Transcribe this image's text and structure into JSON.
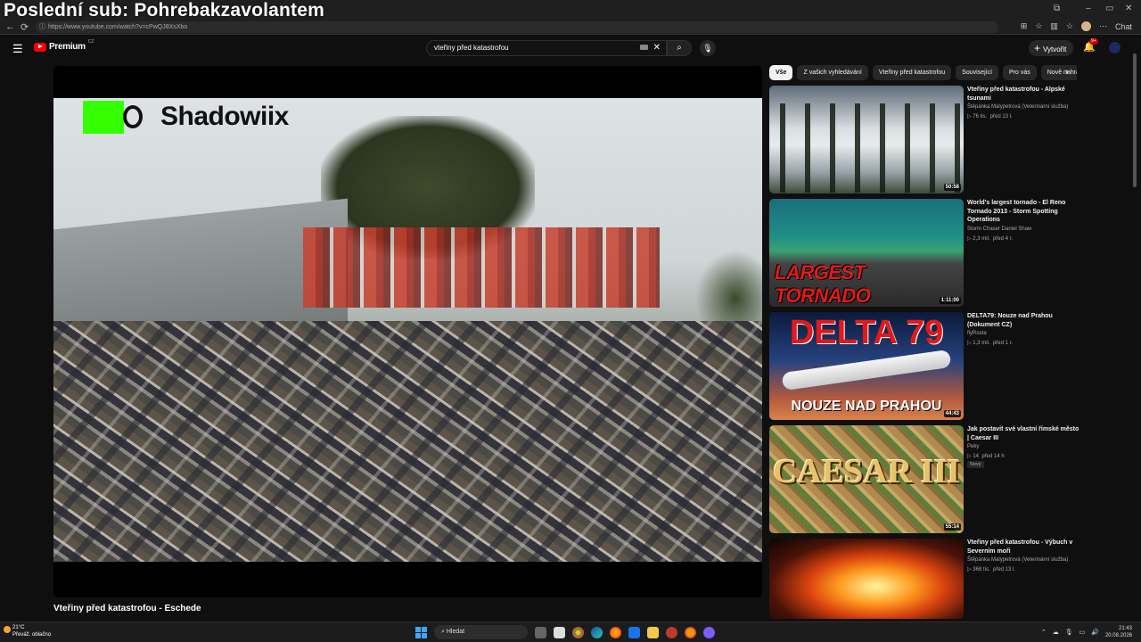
{
  "overlay": {
    "title": "Poslední sub: Pohrebakzavolantem"
  },
  "window": {
    "minimize": "–",
    "maximize": "▭",
    "close": "✕",
    "restore": "⧉"
  },
  "browser": {
    "url": "https://www.youtube.com/watch?v=cPwQJ8XsXbo",
    "back": "←",
    "reload": "⟳",
    "chat_label": "Chat"
  },
  "youtube": {
    "logo_label": "Premium",
    "logo_region": "CZ",
    "search_value": "vteřiny před katastrofou",
    "create_label": "Vytvořit",
    "notif_badge": "9+"
  },
  "player": {
    "watermark": "Shadowiix"
  },
  "video": {
    "title": "Vteřiny před katastrofou - Eschede"
  },
  "chips": [
    "Vše",
    "Z vašich vyhledávání",
    "Vteřiny před katastrofou",
    "Související",
    "Pro vás",
    "Nově nahrané"
  ],
  "recommendations": [
    {
      "title": "Vteřiny před katastrofou - Alpské tsunami",
      "channel": "Štěpánka Malypetrová (Veterinární služba)",
      "views": "76 tis.",
      "age": "před 13 l.",
      "duration": "50:58"
    },
    {
      "title": "World's largest tornado - El Reno Tornado 2013 - Storm Spotting Operations",
      "channel": "Storm Chaser Daniel Shaw",
      "views": "2,3 mil.",
      "age": "před 4 r.",
      "duration": "1:11:00",
      "thumb_text1": "LARGEST",
      "thumb_text2": "TORNADO"
    },
    {
      "title": "DELTA79: Nouze nad Prahou (Dokument CZ)",
      "channel": "flyRosta",
      "views": "1,3 mil.",
      "age": "před 1 r.",
      "duration": "44:43",
      "thumb_big": "DELTA 79",
      "thumb_sub": "NOUZE NAD PRAHOU"
    },
    {
      "title": "Jak postavit své vlastní římské město | Caesar III",
      "channel": "Peky",
      "views": "14",
      "age": "před 14 h",
      "duration": "55:14",
      "badge": "Nový",
      "thumb_text": "CAESAR III"
    },
    {
      "title": "Vteřiny před katastrofou - Výbuch v Severním moři",
      "channel": "Štěpánka Malypetrová (Veterinární služba)",
      "views": "368 tis.",
      "age": "před 13 l.",
      "duration": ""
    }
  ],
  "taskbar": {
    "temp": "21°C",
    "weather": "Převáž. oblačno",
    "search_label": "Hledat",
    "time": "21:43",
    "date": "20.08.2026"
  }
}
